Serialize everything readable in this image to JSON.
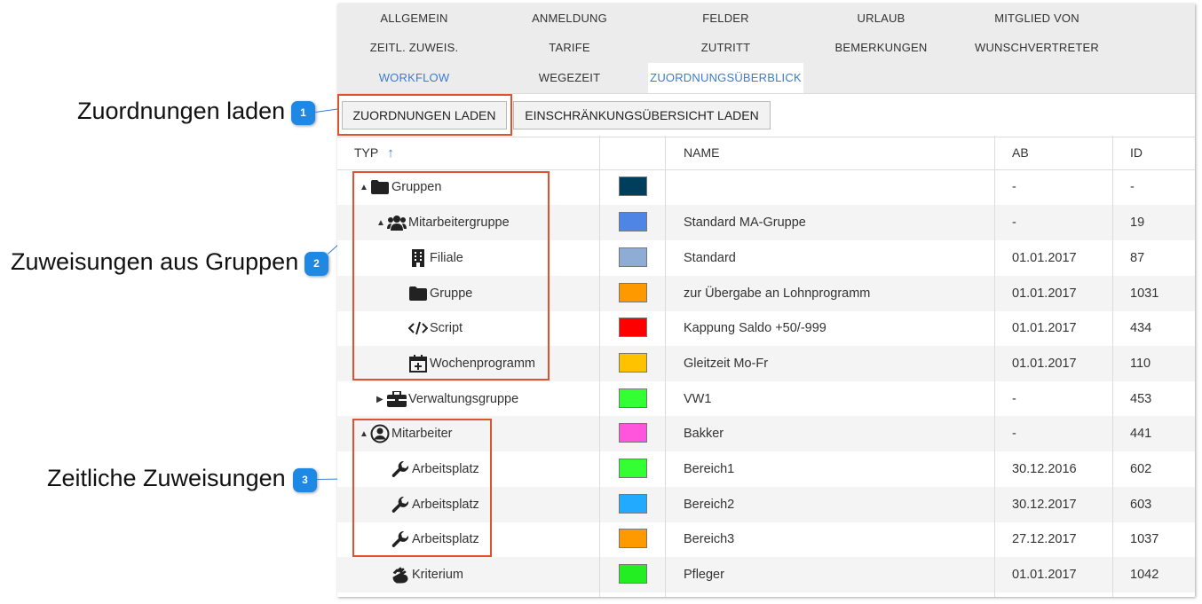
{
  "tabs": [
    {
      "label": "ALLGEMEIN",
      "state": "normal"
    },
    {
      "label": "ANMELDUNG",
      "state": "normal"
    },
    {
      "label": "FELDER",
      "state": "normal"
    },
    {
      "label": "URLAUB",
      "state": "normal"
    },
    {
      "label": "MITGLIED VON",
      "state": "normal"
    },
    {
      "label": "ZEITL. ZUWEIS.",
      "state": "normal"
    },
    {
      "label": "TARIFE",
      "state": "normal"
    },
    {
      "label": "ZUTRITT",
      "state": "normal"
    },
    {
      "label": "BEMERKUNGEN",
      "state": "normal"
    },
    {
      "label": "WUNSCHVERTRETER",
      "state": "normal"
    },
    {
      "label": "WORKFLOW",
      "state": "link"
    },
    {
      "label": "WEGEZEIT",
      "state": "normal"
    },
    {
      "label": "ZUORDNUNGSÜBERBLICK",
      "state": "active"
    }
  ],
  "toolbar": {
    "load_assignments": "ZUORDNUNGEN LADEN",
    "load_restrictions": "EINSCHRÄNKUNGSÜBERSICHT LADEN"
  },
  "table": {
    "columns": {
      "typ": "TYP",
      "name": "NAME",
      "ab": "AB",
      "id": "ID"
    },
    "rows": [
      {
        "type": "Gruppen",
        "icon": "folder-icon",
        "toggle": "▲",
        "name": "",
        "ab": "-",
        "id": "-",
        "color": "#003f5c"
      },
      {
        "type": "Mitarbeitergruppe",
        "icon": "users-icon",
        "toggle": "▲",
        "name": "Standard MA-Gruppe",
        "ab": "-",
        "id": "19",
        "color": "#4f86e6"
      },
      {
        "type": "Filiale",
        "icon": "building-icon",
        "toggle": "",
        "name": "Standard",
        "ab": "01.01.2017",
        "id": "87",
        "color": "#8fadd4"
      },
      {
        "type": "Gruppe",
        "icon": "folder-icon",
        "toggle": "",
        "name": "zur Übergabe an Lohnprogramm",
        "ab": "01.01.2017",
        "id": "1031",
        "color": "#ff9900"
      },
      {
        "type": "Script",
        "icon": "code-icon",
        "toggle": "",
        "name": "Kappung Saldo +50/-999",
        "ab": "01.01.2017",
        "id": "434",
        "color": "#ff0000"
      },
      {
        "type": "Wochenprogramm",
        "icon": "calendar-plus-icon",
        "toggle": "",
        "name": "Gleitzeit Mo-Fr",
        "ab": "01.01.2017",
        "id": "110",
        "color": "#ffc200"
      },
      {
        "type": "Verwaltungsgruppe",
        "icon": "briefcase-icon",
        "toggle": "▶",
        "name": "VW1",
        "ab": "-",
        "id": "453",
        "color": "#33ff33"
      },
      {
        "type": "Mitarbeiter",
        "icon": "user-circle-icon",
        "toggle": "▲",
        "name": "Bakker",
        "ab": "-",
        "id": "441",
        "color": "#ff55dd"
      },
      {
        "type": "Arbeitsplatz",
        "icon": "wrench-icon",
        "toggle": "",
        "name": "Bereich1",
        "ab": "30.12.2016",
        "id": "602",
        "color": "#33ff33"
      },
      {
        "type": "Arbeitsplatz",
        "icon": "wrench-icon",
        "toggle": "",
        "name": "Bereich2",
        "ab": "30.12.2017",
        "id": "603",
        "color": "#22aaff"
      },
      {
        "type": "Arbeitsplatz",
        "icon": "wrench-icon",
        "toggle": "",
        "name": "Bereich3",
        "ab": "27.12.2017",
        "id": "1037",
        "color": "#ff9900"
      },
      {
        "type": "Kriterium",
        "icon": "hand-icon",
        "toggle": "",
        "name": "Pfleger",
        "ab": "01.01.2017",
        "id": "1042",
        "color": "#22ee22"
      }
    ]
  },
  "callouts": [
    {
      "badge": "1",
      "text": "Zuordnungen laden"
    },
    {
      "badge": "2",
      "text": "Zuweisungen aus Gruppen"
    },
    {
      "badge": "3",
      "text": "Zeitliche Zuweisungen"
    }
  ],
  "colors": {
    "accent": "#3a7bd5",
    "highlight_box": "#e0522d",
    "badge": "#1e88e5"
  }
}
